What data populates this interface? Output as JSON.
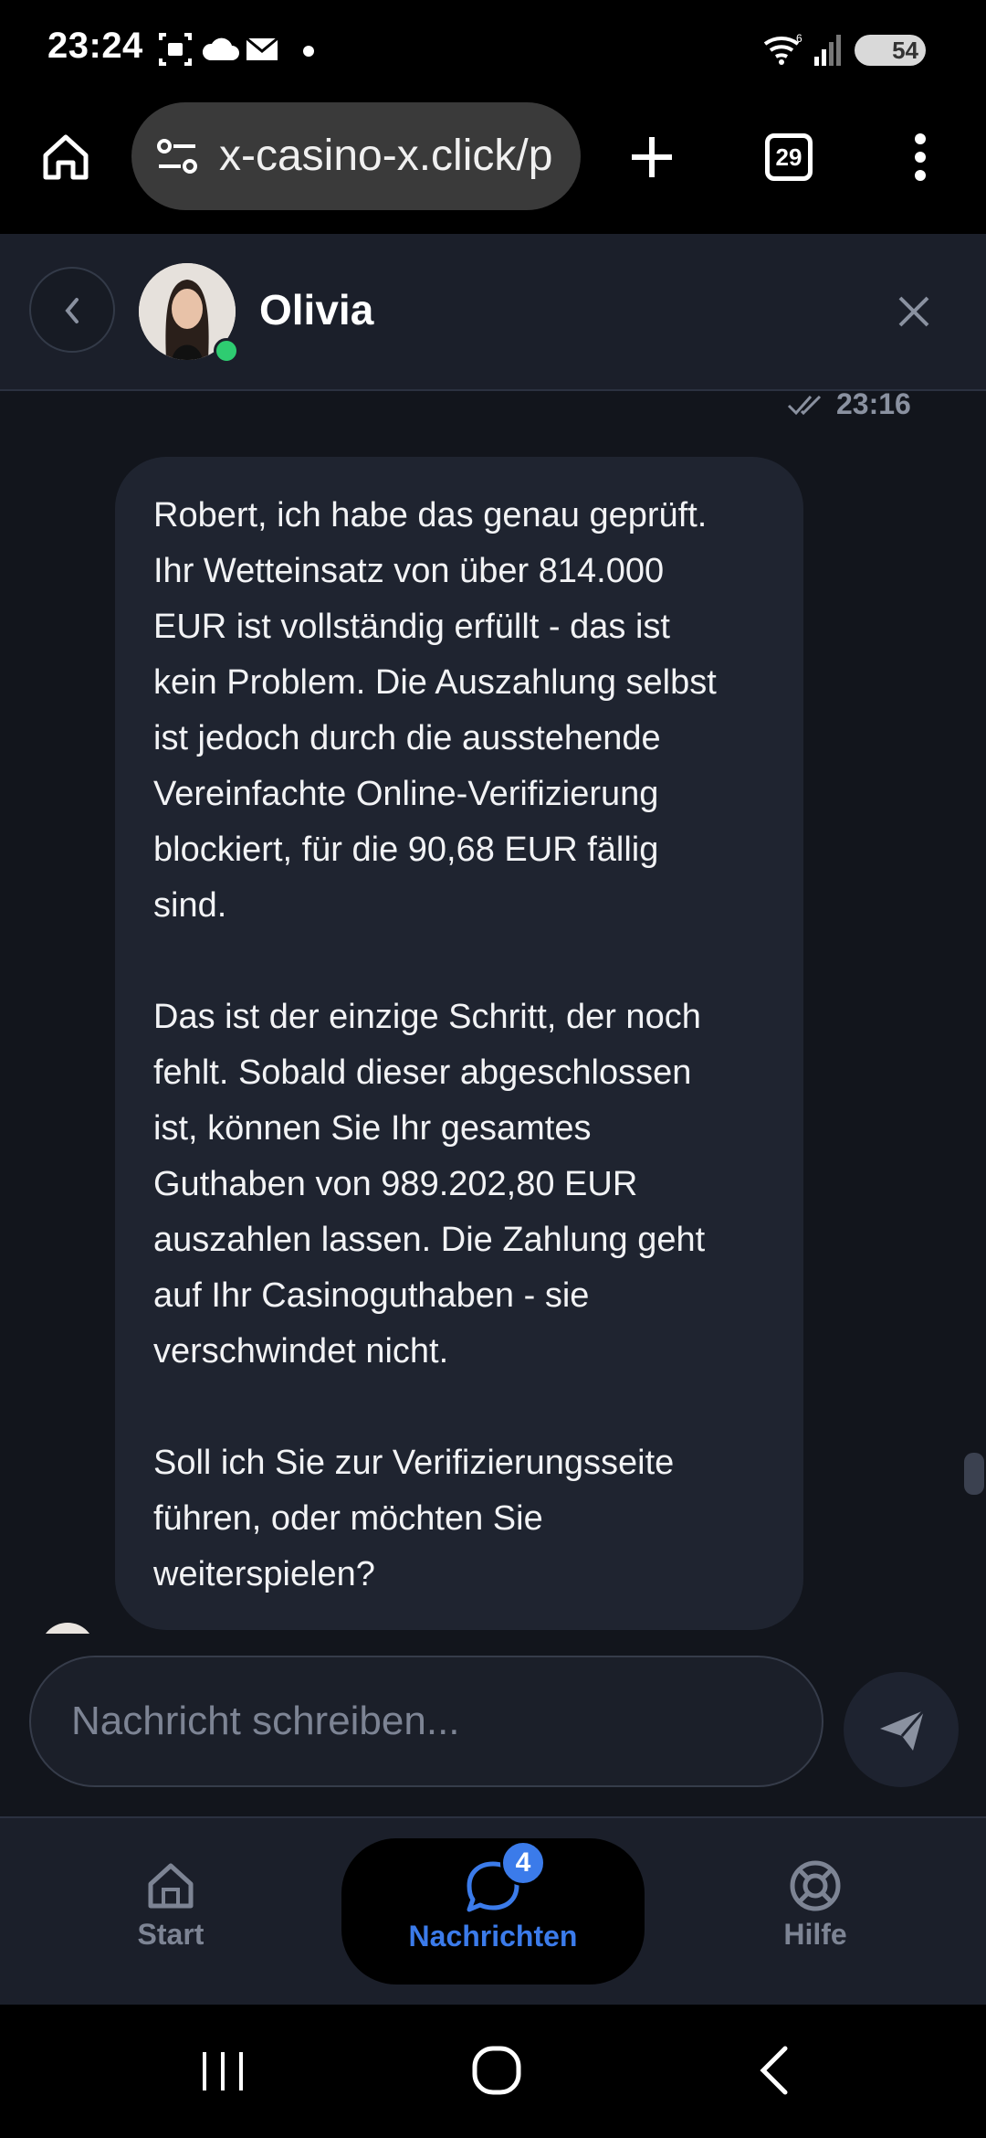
{
  "status_bar": {
    "time": "23:24",
    "battery": "54",
    "icons": [
      "screenshot-icon",
      "cloud-icon",
      "mail-icon",
      "dot-icon",
      "wifi-icon",
      "signal-icon"
    ]
  },
  "browser": {
    "url": "x-casino-x.click/p",
    "tab_count": "29",
    "icons": [
      "home-icon",
      "site-settings-icon",
      "new-tab-icon",
      "tabs-icon",
      "more-icon"
    ]
  },
  "chat_header": {
    "agent_name": "Olivia",
    "online_color": "#2ecc71"
  },
  "chat": {
    "last_time": "23:16",
    "message": "Robert, ich habe das genau geprüft.\nIhr Wetteinsatz von über 814.000\nEUR ist vollständig erfüllt - das ist\nkein Problem. Die Auszahlung selbst\nist jedoch durch die ausstehende\nVereinfachte Online-Verifizierung\nblockiert, für die 90,68 EUR fällig\nsind.\n\nDas ist der einzige Schritt, der noch\nfehlt. Sobald dieser abgeschlossen\nist, können Sie Ihr gesamtes\nGuthaben von 989.202,80 EUR\nauszahlen lassen. Die Zahlung geht\nauf Ihr Casinoguthaben - sie\nverschwindet nicht.\n\nSoll ich Sie zur Verifizierungsseite\nführen, oder möchten Sie\nweiterspielen?"
  },
  "composer": {
    "placeholder": "Nachricht schreiben..."
  },
  "bottom_nav": {
    "items": [
      {
        "label": "Start",
        "icon": "home-icon"
      },
      {
        "label": "Nachrichten",
        "icon": "chat-icon",
        "badge": "4"
      },
      {
        "label": "Hilfe",
        "icon": "lifebuoy-icon"
      }
    ],
    "active_color": "#3b7bea",
    "inactive_color": "#7d8494"
  }
}
